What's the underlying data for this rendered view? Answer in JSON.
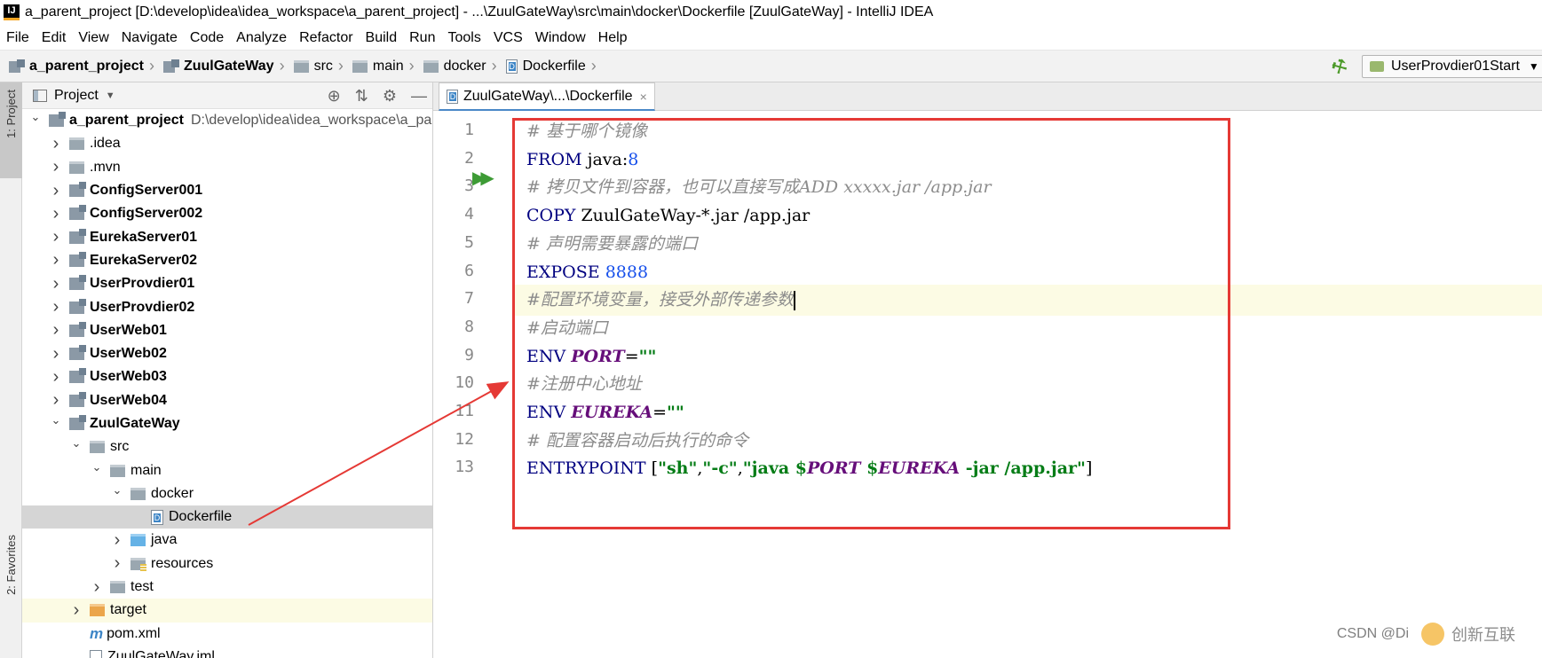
{
  "window": {
    "title": "a_parent_project [D:\\develop\\idea\\idea_workspace\\a_parent_project] - ...\\ZuulGateWay\\src\\main\\docker\\Dockerfile [ZuulGateWay] - IntelliJ IDEA"
  },
  "menu": [
    "File",
    "Edit",
    "View",
    "Navigate",
    "Code",
    "Analyze",
    "Refactor",
    "Build",
    "Run",
    "Tools",
    "VCS",
    "Window",
    "Help"
  ],
  "breadcrumbs": [
    "a_parent_project",
    "ZuulGateWay",
    "src",
    "main",
    "docker",
    "Dockerfile"
  ],
  "run_config": {
    "name": "UserProvdier01Start"
  },
  "side_tabs": {
    "project": "1: Project",
    "favorites": "2: Favorites"
  },
  "project_panel": {
    "title": "Project"
  },
  "tree": [
    {
      "label": "a_parent_project",
      "path": "D:\\develop\\idea\\idea_workspace\\a_pa",
      "bold": true,
      "depth": 0,
      "arrow": "down",
      "icon": "module"
    },
    {
      "label": ".idea",
      "depth": 1,
      "arrow": "right",
      "icon": "folder"
    },
    {
      "label": ".mvn",
      "depth": 1,
      "arrow": "right",
      "icon": "folder"
    },
    {
      "label": "ConfigServer001",
      "bold": true,
      "depth": 1,
      "arrow": "right",
      "icon": "module"
    },
    {
      "label": "ConfigServer002",
      "bold": true,
      "depth": 1,
      "arrow": "right",
      "icon": "module"
    },
    {
      "label": "EurekaServer01",
      "bold": true,
      "depth": 1,
      "arrow": "right",
      "icon": "module"
    },
    {
      "label": "EurekaServer02",
      "bold": true,
      "depth": 1,
      "arrow": "right",
      "icon": "module"
    },
    {
      "label": "UserProvdier01",
      "bold": true,
      "depth": 1,
      "arrow": "right",
      "icon": "module"
    },
    {
      "label": "UserProvdier02",
      "bold": true,
      "depth": 1,
      "arrow": "right",
      "icon": "module"
    },
    {
      "label": "UserWeb01",
      "bold": true,
      "depth": 1,
      "arrow": "right",
      "icon": "module"
    },
    {
      "label": "UserWeb02",
      "bold": true,
      "depth": 1,
      "arrow": "right",
      "icon": "module"
    },
    {
      "label": "UserWeb03",
      "bold": true,
      "depth": 1,
      "arrow": "right",
      "icon": "module"
    },
    {
      "label": "UserWeb04",
      "bold": true,
      "depth": 1,
      "arrow": "right",
      "icon": "module"
    },
    {
      "label": "ZuulGateWay",
      "bold": true,
      "depth": 1,
      "arrow": "down",
      "icon": "module"
    },
    {
      "label": "src",
      "depth": 2,
      "arrow": "down",
      "icon": "folder"
    },
    {
      "label": "main",
      "depth": 3,
      "arrow": "down",
      "icon": "folder"
    },
    {
      "label": "docker",
      "depth": 4,
      "arrow": "down",
      "icon": "folder"
    },
    {
      "label": "Dockerfile",
      "depth": 5,
      "arrow": "",
      "icon": "dfile",
      "selected": true
    },
    {
      "label": "java",
      "depth": 4,
      "arrow": "right",
      "icon": "bluef"
    },
    {
      "label": "resources",
      "depth": 4,
      "arrow": "right",
      "icon": "resf"
    },
    {
      "label": "test",
      "depth": 3,
      "arrow": "right",
      "icon": "folder"
    },
    {
      "label": "target",
      "depth": 2,
      "arrow": "right",
      "icon": "orangef",
      "highlight": true
    },
    {
      "label": "pom.xml",
      "depth": 2,
      "arrow": "",
      "icon": "mvn"
    },
    {
      "label": "ZuulGateWay.iml",
      "depth": 2,
      "arrow": "",
      "icon": "iml"
    }
  ],
  "editor": {
    "tab": "ZuulGateWay\\...\\Dockerfile",
    "lines": [
      {
        "n": "1",
        "tokens": [
          {
            "t": "# 基于哪个镜像",
            "c": "cm"
          }
        ]
      },
      {
        "n": "2",
        "tokens": [
          {
            "t": "FROM ",
            "c": "kw"
          },
          {
            "t": "java:",
            "c": ""
          },
          {
            "t": "8",
            "c": "num"
          }
        ]
      },
      {
        "n": "3",
        "tokens": [
          {
            "t": "# 拷贝文件到容器，也可以直接写成ADD xxxxx.jar /app.jar",
            "c": "cm"
          }
        ]
      },
      {
        "n": "4",
        "tokens": [
          {
            "t": "COPY ",
            "c": "kw"
          },
          {
            "t": "ZuulGateWay-*.jar /app.jar",
            "c": ""
          }
        ]
      },
      {
        "n": "5",
        "tokens": [
          {
            "t": "# 声明需要暴露的端口",
            "c": "cm"
          }
        ]
      },
      {
        "n": "6",
        "tokens": [
          {
            "t": "EXPOSE ",
            "c": "kw"
          },
          {
            "t": "8888",
            "c": "num"
          }
        ]
      },
      {
        "n": "7",
        "tokens": [
          {
            "t": "#配置环境变量，接受外部传递参数",
            "c": "cm"
          }
        ],
        "current": true
      },
      {
        "n": "8",
        "tokens": [
          {
            "t": "#启动端口",
            "c": "cm"
          }
        ]
      },
      {
        "n": "9",
        "tokens": [
          {
            "t": "ENV ",
            "c": "kw"
          },
          {
            "t": "PORT",
            "c": "var"
          },
          {
            "t": "=",
            "c": ""
          },
          {
            "t": "\"\"",
            "c": "str"
          }
        ]
      },
      {
        "n": "10",
        "tokens": [
          {
            "t": "#注册中心地址",
            "c": "cm"
          }
        ]
      },
      {
        "n": "11",
        "tokens": [
          {
            "t": "ENV ",
            "c": "kw"
          },
          {
            "t": "EUREKA",
            "c": "var"
          },
          {
            "t": "=",
            "c": ""
          },
          {
            "t": "\"\"",
            "c": "str"
          }
        ]
      },
      {
        "n": "12",
        "tokens": [
          {
            "t": "# 配置容器启动后执行的命令",
            "c": "cm"
          }
        ]
      },
      {
        "n": "13",
        "tokens": [
          {
            "t": "ENTRYPOINT ",
            "c": "kw"
          },
          {
            "t": "[",
            "c": ""
          },
          {
            "t": "\"sh\"",
            "c": "str"
          },
          {
            "t": ",",
            "c": ""
          },
          {
            "t": "\"-c\"",
            "c": "str"
          },
          {
            "t": ",",
            "c": ""
          },
          {
            "t": "\"java $",
            "c": "str"
          },
          {
            "t": "PORT",
            "c": "var"
          },
          {
            "t": " $",
            "c": "str"
          },
          {
            "t": "EUREKA",
            "c": "var"
          },
          {
            "t": " -jar /app.jar\"",
            "c": "str"
          },
          {
            "t": "]",
            "c": ""
          }
        ]
      }
    ]
  },
  "watermark": {
    "text": "CSDN @Di",
    "brand": "创新互联"
  },
  "colors": {
    "keyword": "#000080",
    "comment": "#8c8c8c",
    "number": "#1750eb",
    "variable": "#660e7a",
    "string": "#067d17",
    "annotation": "#e53935",
    "run": "#3d9b35"
  }
}
